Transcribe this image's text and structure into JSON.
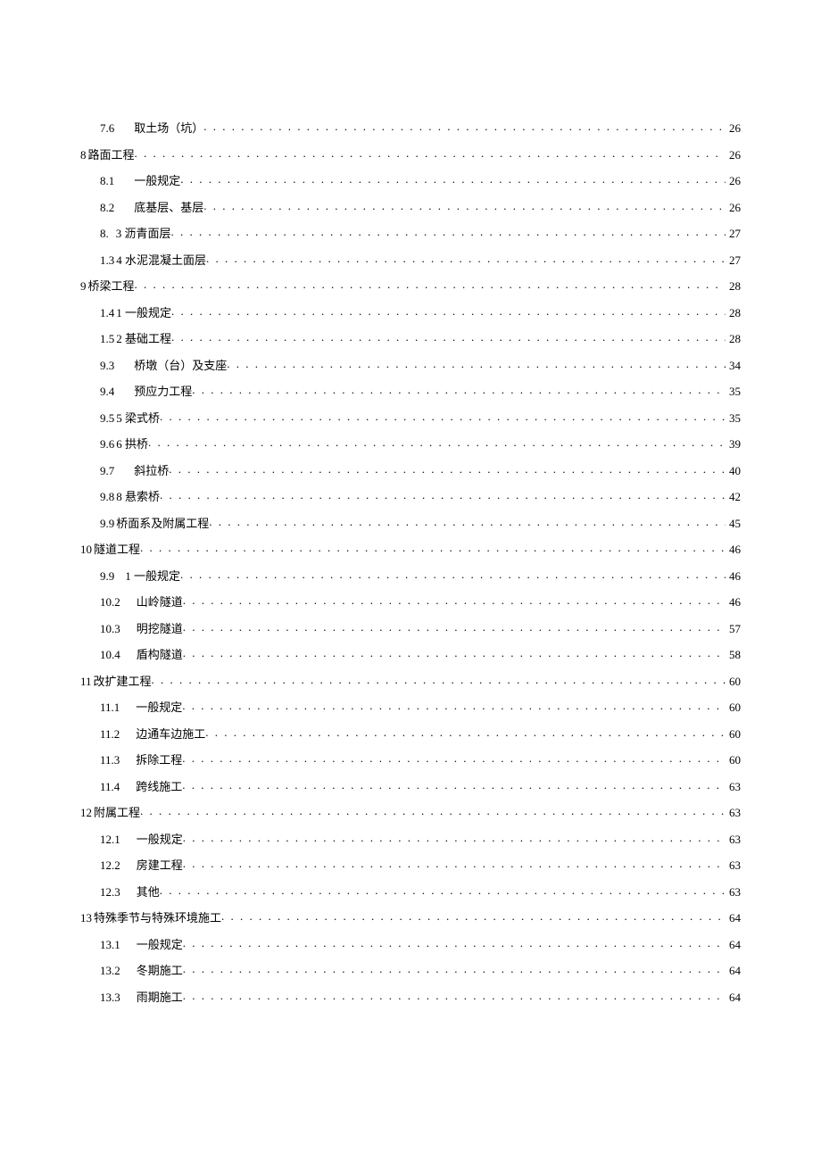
{
  "toc": [
    {
      "indent": 1,
      "num": "7.6",
      "gap": 22,
      "title": "取土场（坑）",
      "page": "26"
    },
    {
      "indent": 0,
      "num": "8",
      "gap": 2,
      "title": "路面工程",
      "page": "26"
    },
    {
      "indent": 1,
      "num": "8.1",
      "gap": 22,
      "title": "一般规定",
      "page": "26"
    },
    {
      "indent": 1,
      "num": "8.2",
      "gap": 22,
      "title": "底基层、基层",
      "page": "26"
    },
    {
      "indent": 1,
      "num": "8.",
      "gap": 8,
      "title": "3 沥青面层",
      "page": "27"
    },
    {
      "indent": 1,
      "num": "1.3",
      "gap": 2,
      "title": "4 水泥混凝土面层",
      "page": "27"
    },
    {
      "indent": 0,
      "num": "9",
      "gap": 2,
      "title": "桥梁工程",
      "page": "28"
    },
    {
      "indent": 1,
      "num": "1.4",
      "gap": 2,
      "title": "1 一般规定",
      "page": "28"
    },
    {
      "indent": 1,
      "num": "1.5",
      "gap": 2,
      "title": "2 基础工程",
      "page": "28"
    },
    {
      "indent": 1,
      "num": "9.3",
      "gap": 22,
      "title": "桥墩（台）及支座",
      "page": "34"
    },
    {
      "indent": 1,
      "num": "9.4",
      "gap": 22,
      "title": "预应力工程",
      "page": "35"
    },
    {
      "indent": 1,
      "num": "9.5",
      "gap": 2,
      "title": "5 梁式桥",
      "page": "35"
    },
    {
      "indent": 1,
      "num": "9.6",
      "gap": 2,
      "title": "6 拱桥",
      "page": "39"
    },
    {
      "indent": 1,
      "num": "9.7",
      "gap": 22,
      "title": "斜拉桥",
      "page": "40"
    },
    {
      "indent": 1,
      "num": "9.8",
      "gap": 2,
      "title": "8 悬索桥",
      "page": "42"
    },
    {
      "indent": 1,
      "num": "9.9",
      "gap": 2,
      "title": "桥面系及附属工程",
      "page": "45"
    },
    {
      "indent": 0,
      "num": "10",
      "gap": 2,
      "title": "隧道工程",
      "page": "46"
    },
    {
      "indent": 1,
      "num": "9.9",
      "gap": 12,
      "title": "1 一般规定",
      "page": "46"
    },
    {
      "indent": 1,
      "num": "10.2",
      "gap": 18,
      "title": "山岭隧道",
      "page": "46"
    },
    {
      "indent": 1,
      "num": "10.3",
      "gap": 18,
      "title": "明挖隧道",
      "page": "57"
    },
    {
      "indent": 1,
      "num": "10.4",
      "gap": 18,
      "title": "盾构隧道",
      "page": "58"
    },
    {
      "indent": 0,
      "num": "11",
      "gap": 2,
      "title": "改扩建工程",
      "page": "60"
    },
    {
      "indent": 1,
      "num": "11.1",
      "gap": 18,
      "title": "一般规定",
      "page": "60"
    },
    {
      "indent": 1,
      "num": "11.2",
      "gap": 18,
      "title": "边通车边施工",
      "page": "60"
    },
    {
      "indent": 1,
      "num": "11.3",
      "gap": 18,
      "title": "拆除工程",
      "page": "60"
    },
    {
      "indent": 1,
      "num": "11.4",
      "gap": 18,
      "title": "跨线施工",
      "page": "63"
    },
    {
      "indent": 0,
      "num": "12",
      "gap": 2,
      "title": "附属工程",
      "page": "63"
    },
    {
      "indent": 1,
      "num": "12.1",
      "gap": 18,
      "title": "一般规定",
      "page": "63"
    },
    {
      "indent": 1,
      "num": "12.2",
      "gap": 18,
      "title": "房建工程",
      "page": "63"
    },
    {
      "indent": 1,
      "num": "12.3",
      "gap": 18,
      "title": "其他",
      "page": "63"
    },
    {
      "indent": 0,
      "num": "13",
      "gap": 2,
      "title": "特殊季节与特殊环境施工",
      "page": "64"
    },
    {
      "indent": 1,
      "num": "13.1",
      "gap": 18,
      "title": "一般规定",
      "page": "64"
    },
    {
      "indent": 1,
      "num": "13.2",
      "gap": 18,
      "title": "冬期施工",
      "page": "64"
    },
    {
      "indent": 1,
      "num": "13.3",
      "gap": 18,
      "title": "雨期施工",
      "page": "64"
    }
  ]
}
